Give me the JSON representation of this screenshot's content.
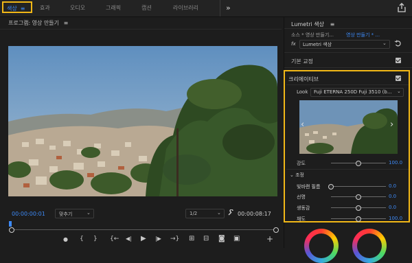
{
  "workspaces": {
    "tabs": [
      {
        "label": "색상",
        "menu_glyph": "≡"
      },
      {
        "label": "효과"
      },
      {
        "label": "오디오"
      },
      {
        "label": "그래픽"
      },
      {
        "label": "캡션"
      },
      {
        "label": "라이브러리"
      }
    ],
    "more_glyph": "»"
  },
  "program": {
    "title": "프로그램: 영상 만들기",
    "menu_glyph": "≡",
    "timecode_current": "00:00:00:01",
    "fit_label": "맞추기",
    "resolution": "1/2",
    "timecode_duration": "00:00:08:17"
  },
  "lumetri": {
    "panel_title": "Lumetri 색상",
    "menu_glyph": "≡",
    "source_label": "소스 * 영상 만들기...",
    "sequence_label": "영상 만들기 * ...",
    "fx_label": "fx",
    "effect_name": "Lumetri 색상",
    "basic_correction": "기본 교정",
    "creative": {
      "title": "크리에이티브",
      "look_label": "Look",
      "look_value": "Fuji ETERNA 250D Fuji 3510 (b...",
      "intensity_label": "강도",
      "intensity_value": "100.0",
      "intensity_level": 0.5,
      "adjustments_label": "조정",
      "adjustments": [
        {
          "label": "빛바랜 필름",
          "value": "0.0",
          "level": 0.0
        },
        {
          "label": "선명",
          "value": "0.0",
          "level": 0.5
        },
        {
          "label": "생동감",
          "value": "0.0",
          "level": 0.5
        },
        {
          "label": "채도",
          "value": "100.0",
          "level": 0.5
        }
      ]
    }
  },
  "transport": {
    "marker": "●",
    "in": "{",
    "out": "}",
    "go_in": "{←",
    "step_back": "◀|",
    "play": "▶",
    "step_fwd": "|▶",
    "go_out": "→}",
    "insert": "⊞",
    "overwrite": "⊟",
    "export_frame": "◙",
    "compare": "▣",
    "add": "+"
  },
  "colors": {
    "accent": "#3d8af7",
    "highlight": "#f2b817",
    "background": "#1d1d1d"
  }
}
